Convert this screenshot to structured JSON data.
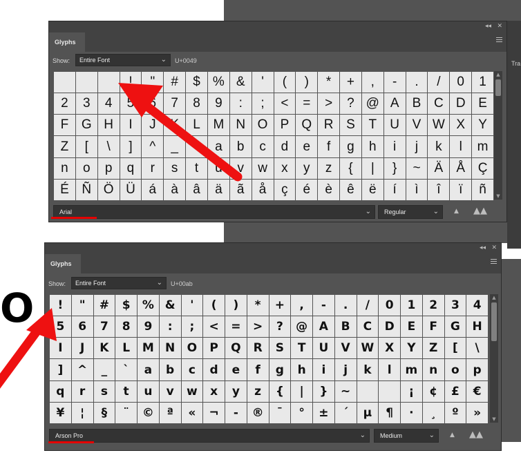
{
  "bg_overlay": {
    "letter": "O",
    "right_label": "Tra"
  },
  "panel1": {
    "title_buttons": {
      "collapse": "◂◂",
      "close": "✕"
    },
    "tab": "Glyphs",
    "show_label": "Show:",
    "show_value": "Entire Font",
    "unicode": "U+0049",
    "glyphs": [
      [
        "",
        "",
        "",
        "!",
        "\"",
        "#",
        "$",
        "%",
        "&",
        "'",
        "(",
        ")",
        "*",
        "+",
        ",",
        "-",
        ".",
        "/",
        "0",
        "1"
      ],
      [
        "2",
        "3",
        "4",
        "5",
        "6",
        "7",
        "8",
        "9",
        ":",
        ";",
        "<",
        "=",
        ">",
        "?",
        "@",
        "A",
        "B",
        "C",
        "D",
        "E"
      ],
      [
        "F",
        "G",
        "H",
        "I",
        "J",
        "K",
        "L",
        "M",
        "N",
        "O",
        "P",
        "Q",
        "R",
        "S",
        "T",
        "U",
        "V",
        "W",
        "X",
        "Y"
      ],
      [
        "Z",
        "[",
        "\\",
        "]",
        "^",
        "_",
        "`",
        "a",
        "b",
        "c",
        "d",
        "e",
        "f",
        "g",
        "h",
        "i",
        "j",
        "k",
        "l",
        "m"
      ],
      [
        "n",
        "o",
        "p",
        "q",
        "r",
        "s",
        "t",
        "u",
        "v",
        "w",
        "x",
        "y",
        "z",
        "{",
        "|",
        "}",
        "~",
        "Ä",
        "Å",
        "Ç"
      ],
      [
        "É",
        "Ñ",
        "Ö",
        "Ü",
        "á",
        "à",
        "â",
        "ä",
        "ã",
        "å",
        "ç",
        "é",
        "è",
        "ê",
        "ë",
        "í",
        "ì",
        "î",
        "ï",
        "ñ"
      ]
    ],
    "font_name": "Arial",
    "font_style": "Regular"
  },
  "panel2": {
    "title_buttons": {
      "collapse": "◂◂",
      "close": "✕"
    },
    "tab": "Glyphs",
    "show_label": "Show:",
    "show_value": "Entire Font",
    "unicode": "U+00ab",
    "glyphs": [
      [
        "!",
        "\"",
        "#",
        "$",
        "%",
        "&",
        "'",
        "(",
        ")",
        "*",
        "+",
        ",",
        "-",
        ".",
        "/",
        "0",
        "1",
        "2",
        "3",
        "4"
      ],
      [
        "5",
        "6",
        "7",
        "8",
        "9",
        ":",
        ";",
        "<",
        "=",
        ">",
        "?",
        "@",
        "A",
        "B",
        "C",
        "D",
        "E",
        "F",
        "G",
        "H"
      ],
      [
        "I",
        "J",
        "K",
        "L",
        "M",
        "N",
        "O",
        "P",
        "Q",
        "R",
        "S",
        "T",
        "U",
        "V",
        "W",
        "X",
        "Y",
        "Z",
        "[",
        "\\"
      ],
      [
        "]",
        "^",
        "_",
        "`",
        "a",
        "b",
        "c",
        "d",
        "e",
        "f",
        "g",
        "h",
        "i",
        "j",
        "k",
        "l",
        "m",
        "n",
        "o",
        "p"
      ],
      [
        "q",
        "r",
        "s",
        "t",
        "u",
        "v",
        "w",
        "x",
        "y",
        "z",
        "{",
        "|",
        "}",
        "~",
        "",
        "",
        "¡",
        "¢",
        "£",
        "€"
      ],
      [
        "¥",
        "¦",
        "§",
        "¨",
        "©",
        "ª",
        "«",
        "¬",
        "-",
        "®",
        "¯",
        "°",
        "±",
        "´",
        "µ",
        "¶",
        "·",
        "¸",
        "º",
        "»"
      ]
    ],
    "font_name": "Arson Pro",
    "font_style": "Medium"
  },
  "icons": {
    "dropdown": "chevron-down-icon",
    "size_small": "mountain-small-icon",
    "size_large": "mountain-large-icon",
    "menu": "panel-menu-icon"
  },
  "colors": {
    "panel": "#535353",
    "titlebar": "#424242",
    "cell": "#e9e9e9",
    "annotation_red": "#e50000"
  }
}
